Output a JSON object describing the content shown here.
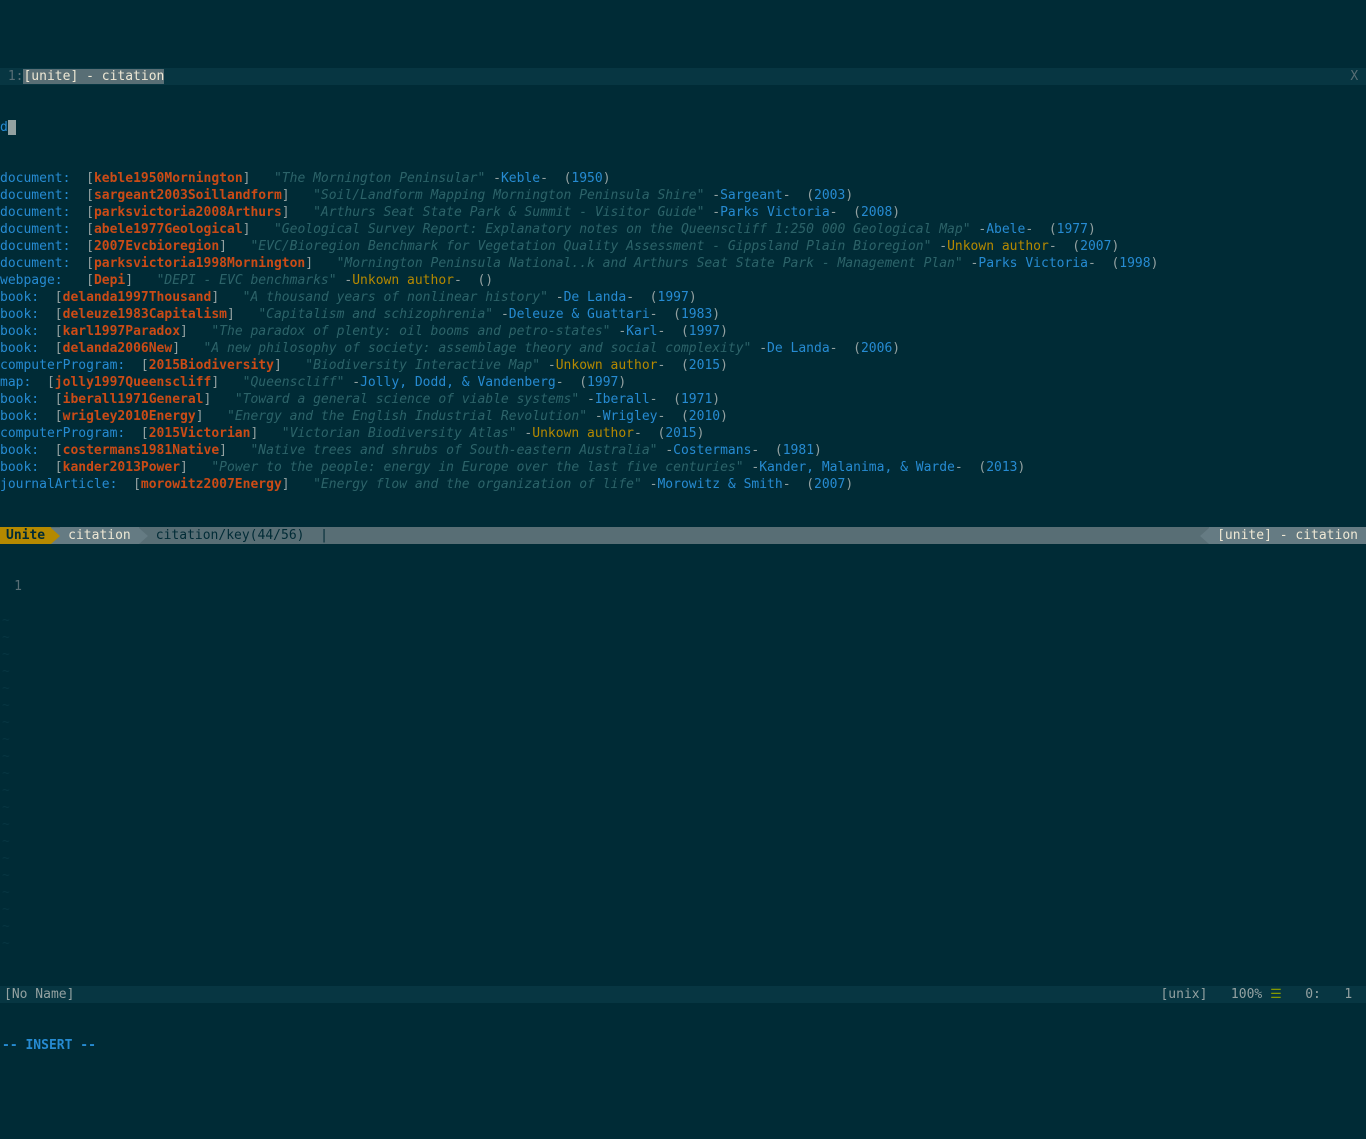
{
  "tabline": {
    "prefix": " 1:",
    "title": "[unite] - citation",
    "close": "X "
  },
  "prompt": {
    "char": "d",
    "cursor": " "
  },
  "entries": [
    {
      "type": "document:",
      "key": "keble1950Mornington",
      "title": "\"The Mornington Peninsular\"",
      "author": "Keble",
      "unknown": false,
      "year": "1950"
    },
    {
      "type": "document:",
      "key": "sargeant2003Soillandform",
      "title": "\"Soil/Landform Mapping Mornington Peninsula Shire\"",
      "author": "Sargeant",
      "unknown": false,
      "year": "2003"
    },
    {
      "type": "document:",
      "key": "parksvictoria2008Arthurs",
      "title": "\"Arthurs Seat State Park & Summit - Visitor Guide\"",
      "author": "Parks Victoria",
      "unknown": false,
      "year": "2008"
    },
    {
      "type": "document:",
      "key": "abele1977Geological",
      "title": "\"Geological Survey Report: Explanatory notes on the Queenscliff 1:250 000 Geological Map\"",
      "author": "Abele",
      "unknown": false,
      "year": "1977"
    },
    {
      "type": "document:",
      "key": "2007Evcbioregion",
      "title": "\"EVC/Bioregion Benchmark for Vegetation Quality Assessment - Gippsland Plain Bioregion\"",
      "author": "Unkown author",
      "unknown": true,
      "year": "2007"
    },
    {
      "type": "document:",
      "key": "parksvictoria1998Mornington",
      "title": "\"Mornington Peninsula National..k and Arthurs Seat State Park - Management Plan\"",
      "author": "Parks Victoria",
      "unknown": false,
      "year": "1998"
    },
    {
      "type": "webpage:",
      "key": "Depi",
      "title": "\"DEPI - EVC benchmarks\"",
      "author": "Unkown author",
      "unknown": true,
      "year": ""
    },
    {
      "type": "book:",
      "key": "delanda1997Thousand",
      "title": "\"A thousand years of nonlinear history\"",
      "author": "De Landa",
      "unknown": false,
      "year": "1997"
    },
    {
      "type": "book:",
      "key": "deleuze1983Capitalism",
      "title": "\"Capitalism and schizophrenia\"",
      "author": "Deleuze & Guattari",
      "unknown": false,
      "year": "1983"
    },
    {
      "type": "book:",
      "key": "karl1997Paradox",
      "title": "\"The paradox of plenty: oil booms and petro-states\"",
      "author": "Karl",
      "unknown": false,
      "year": "1997"
    },
    {
      "type": "book:",
      "key": "delanda2006New",
      "title": "\"A new philosophy of society: assemblage theory and social complexity\"",
      "author": "De Landa",
      "unknown": false,
      "year": "2006"
    },
    {
      "type": "computerProgram:",
      "key": "2015Biodiversity",
      "title": "\"Biodiversity Interactive Map\"",
      "author": "Unkown author",
      "unknown": true,
      "year": "2015"
    },
    {
      "type": "map:",
      "key": "jolly1997Queenscliff",
      "title": "\"Queenscliff\"",
      "author": "Jolly, Dodd, & Vandenberg",
      "unknown": false,
      "year": "1997"
    },
    {
      "type": "book:",
      "key": "iberall1971General",
      "title": "\"Toward a general science of viable systems\"",
      "author": "Iberall",
      "unknown": false,
      "year": "1971"
    },
    {
      "type": "book:",
      "key": "wrigley2010Energy",
      "title": "\"Energy and the English Industrial Revolution\"",
      "author": "Wrigley",
      "unknown": false,
      "year": "2010"
    },
    {
      "type": "computerProgram:",
      "key": "2015Victorian",
      "title": "\"Victorian Biodiversity Atlas\"",
      "author": "Unkown author",
      "unknown": true,
      "year": "2015"
    },
    {
      "type": "book:",
      "key": "costermans1981Native",
      "title": "\"Native trees and shrubs of South-eastern Australia\"",
      "author": "Costermans",
      "unknown": false,
      "year": "1981"
    },
    {
      "type": "book:",
      "key": "kander2013Power",
      "title": "\"Power to the people: energy in Europe over the last five centuries\"",
      "author": "Kander, Malanima, & Warde",
      "unknown": false,
      "year": "2013"
    },
    {
      "type": "journalArticle:",
      "key": "morowitz2007Energy",
      "title": "\"Energy flow and the organization of life\"",
      "author": "Morowitz & Smith",
      "unknown": false,
      "year": "2007"
    }
  ],
  "statusline": {
    "unite": "Unite",
    "citation": "citation",
    "info": "citation/key(44/56)  |",
    "right": "[unite] - citation"
  },
  "buffer": {
    "line1": "1"
  },
  "tilde_count": 20,
  "bottom": {
    "name": "[No Name]",
    "fileinfo": "[unix]   100% ",
    "ln": "☰",
    "pos": "   0:   1 "
  },
  "mode": "-- INSERT --"
}
